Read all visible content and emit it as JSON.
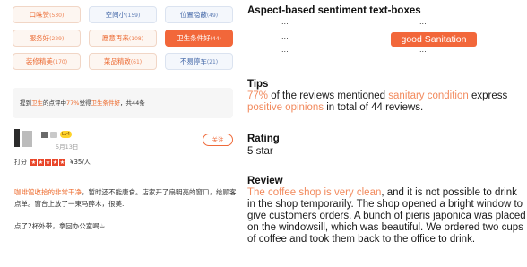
{
  "tags": [
    [
      {
        "label": "口味赞",
        "count": "(530)",
        "style": "orange"
      },
      {
        "label": "空间小",
        "count": "(159)",
        "style": "blue"
      },
      {
        "label": "位置隐蔽",
        "count": "(49)",
        "style": "blue"
      }
    ],
    [
      {
        "label": "服务好",
        "count": "(229)",
        "style": "orange"
      },
      {
        "label": "愿意再来",
        "count": "(108)",
        "style": "orange"
      },
      {
        "label": "卫生条件好",
        "count": "(44)",
        "style": "active"
      }
    ],
    [
      {
        "label": "装修精美",
        "count": "(170)",
        "style": "orange"
      },
      {
        "label": "菜品精致",
        "count": "(61)",
        "style": "orange"
      },
      {
        "label": "不易停车",
        "count": "(21)",
        "style": "blue"
      }
    ]
  ],
  "summary": {
    "pre": "提到",
    "topic": "卫生",
    "mid": "的点评中",
    "pct": "77%",
    "mid2": "觉得",
    "condition": "卫生条件好",
    "post": "，共44条"
  },
  "user": {
    "level_badge": "Lv4",
    "date": "5月13日",
    "follow_label": "关注"
  },
  "rating": {
    "label": "打分",
    "stars": [
      "★",
      "★",
      "★",
      "★",
      "★"
    ],
    "price": "¥35/人"
  },
  "review_zh": {
    "highlight": "咖啡馆收拾的非常干净",
    "rest": "，暂时还不能唐食。店家开了扇明亮的窗口，给顾客点单。窗台上放了一束马醉木，很美..",
    "line2": "点了2杯外带，拿回办公室喝☕"
  },
  "annotation": {
    "textboxes_title": "Aspect-based sentiment text-boxes",
    "dots": "...",
    "aspect_label": "good Sanitation",
    "tips_title": "Tips",
    "tips": {
      "pct": "77%",
      "t1": " of the reviews mentioned ",
      "condition": "sanitary condition",
      "t2": " express ",
      "opinion": "positive opinions",
      "t3": " in total of 44 reviews."
    },
    "rating_title": "Rating",
    "rating_value": "5 star",
    "review_title": "Review",
    "review": {
      "highlight": "The coffee shop is very clean",
      "rest": ", and it is not possible to drink in the shop temporarily. The shop opened a bright window to give customers orders. A bunch of pieris japonica was placed on the windowsill, which was beautiful. We ordered two cups of coffee and took them back to the office to drink."
    }
  }
}
